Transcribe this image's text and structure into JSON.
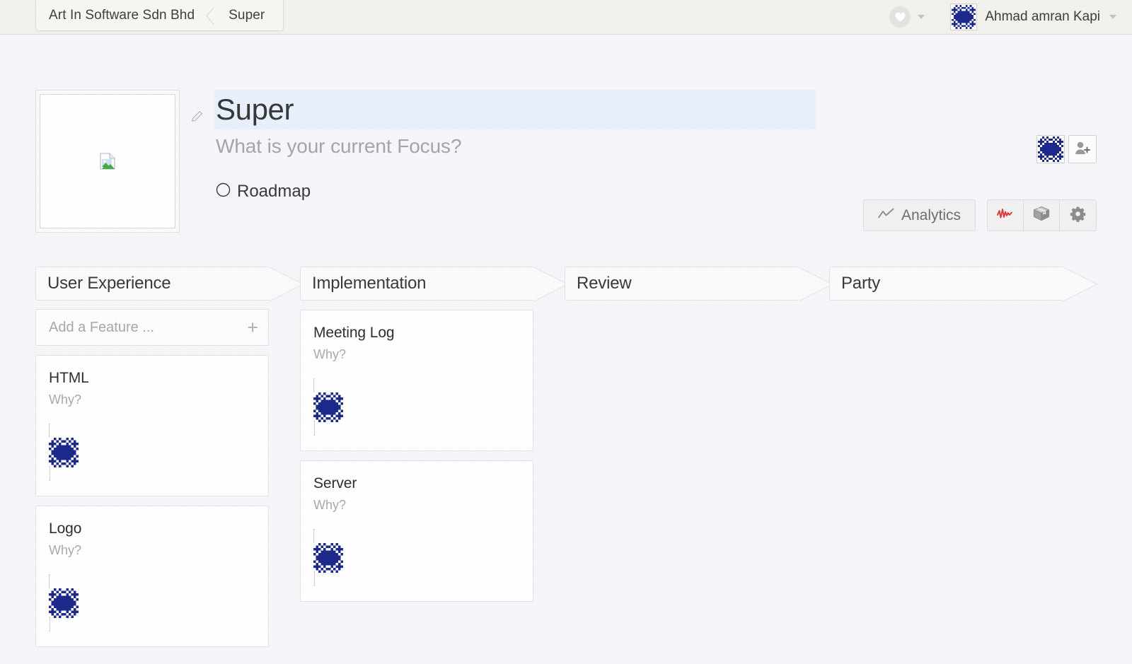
{
  "topbar": {
    "breadcrumb": {
      "org": "Art In Software Sdn Bhd",
      "project": "Super"
    },
    "heart_icon": "heart-icon",
    "heart_caret": "chevron-down-icon",
    "user": {
      "name": "Ahmad amran Kapi",
      "avatar_icon": "identicon-avatar",
      "caret_icon": "chevron-down-icon"
    }
  },
  "project": {
    "thumbnail_icon": "broken-image-placeholder-icon",
    "edit_icon": "pencil-icon",
    "title": "Super",
    "subtitle": "What is your current Focus?",
    "roadmap_icon": "compass-icon",
    "roadmap_label": "Roadmap",
    "member_avatar_icon": "identicon-avatar",
    "add_person_icon": "add-person-icon",
    "analytics_label": "Analytics",
    "analytics_icon": "line-chart-icon",
    "tools": [
      {
        "name": "activity",
        "icon": "activity-pulse-icon",
        "color": "#e0363b"
      },
      {
        "name": "package",
        "icon": "box-package-icon",
        "color": "#8d8d8d"
      },
      {
        "name": "settings",
        "icon": "gear-icon",
        "color": "#8d8d8d"
      }
    ]
  },
  "board": {
    "add_feature_placeholder": "Add a Feature ...",
    "add_feature_icon": "plus-icon",
    "columns": [
      {
        "title": "User Experience",
        "has_add_feature": true,
        "cards": [
          {
            "title": "HTML",
            "why": "Why?",
            "avatar_icon": "identicon-avatar"
          },
          {
            "title": "Logo",
            "why": "Why?",
            "avatar_icon": "identicon-avatar"
          }
        ]
      },
      {
        "title": "Implementation",
        "has_add_feature": false,
        "cards": [
          {
            "title": "Meeting Log",
            "why": "Why?",
            "avatar_icon": "identicon-avatar"
          },
          {
            "title": "Server",
            "why": "Why?",
            "avatar_icon": "identicon-avatar"
          }
        ]
      },
      {
        "title": "Review",
        "has_add_feature": false,
        "cards": []
      },
      {
        "title": "Party",
        "has_add_feature": false,
        "cards": []
      }
    ]
  },
  "colors": {
    "identicon_blue": "#1d2a8c",
    "title_highlight": "#e8f1fb",
    "topbar_bg": "#f2f1ec",
    "main_bg": "#f5f6f9",
    "activity_red": "#e0363b"
  }
}
